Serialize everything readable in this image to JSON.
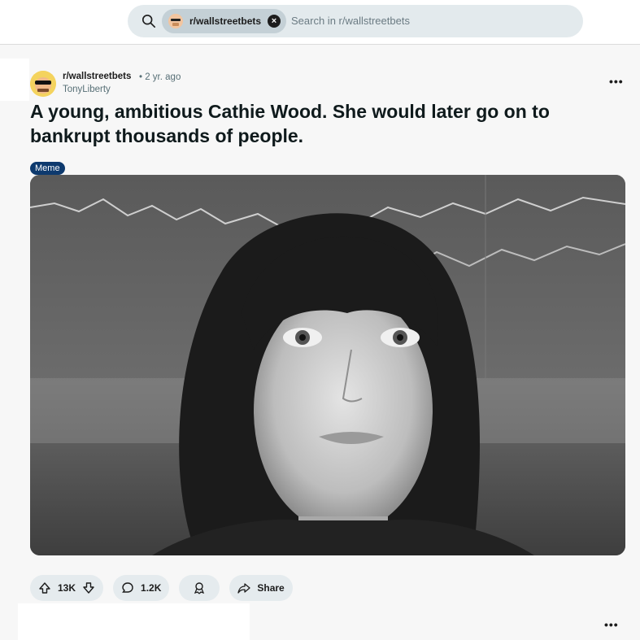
{
  "search": {
    "community_chip": "r/wallstreetbets",
    "placeholder": "Search in r/wallstreetbets"
  },
  "post": {
    "subreddit": "r/wallstreetbets",
    "time": "• 2 yr. ago",
    "author": "TonyLiberty",
    "title": "A young, ambitious Cathie Wood. She would later go on to bankrupt thousands of people.",
    "flair": "Meme",
    "image_description": "black and white portrait photo of a young woman with dark bangs in front of a stock ticker chart",
    "votes": "13K",
    "comments": "1.2K",
    "share_label": "Share"
  },
  "icons": {
    "search": "search-icon",
    "close": "close-icon",
    "more": "more-options-icon",
    "upvote": "upvote-icon",
    "downvote": "downvote-icon",
    "comment": "comment-icon",
    "award": "award-icon",
    "share": "share-icon"
  },
  "colors": {
    "flair_bg": "#0e3a6e",
    "search_bg": "#e3eaed",
    "pill_bg": "#e5ebee"
  }
}
